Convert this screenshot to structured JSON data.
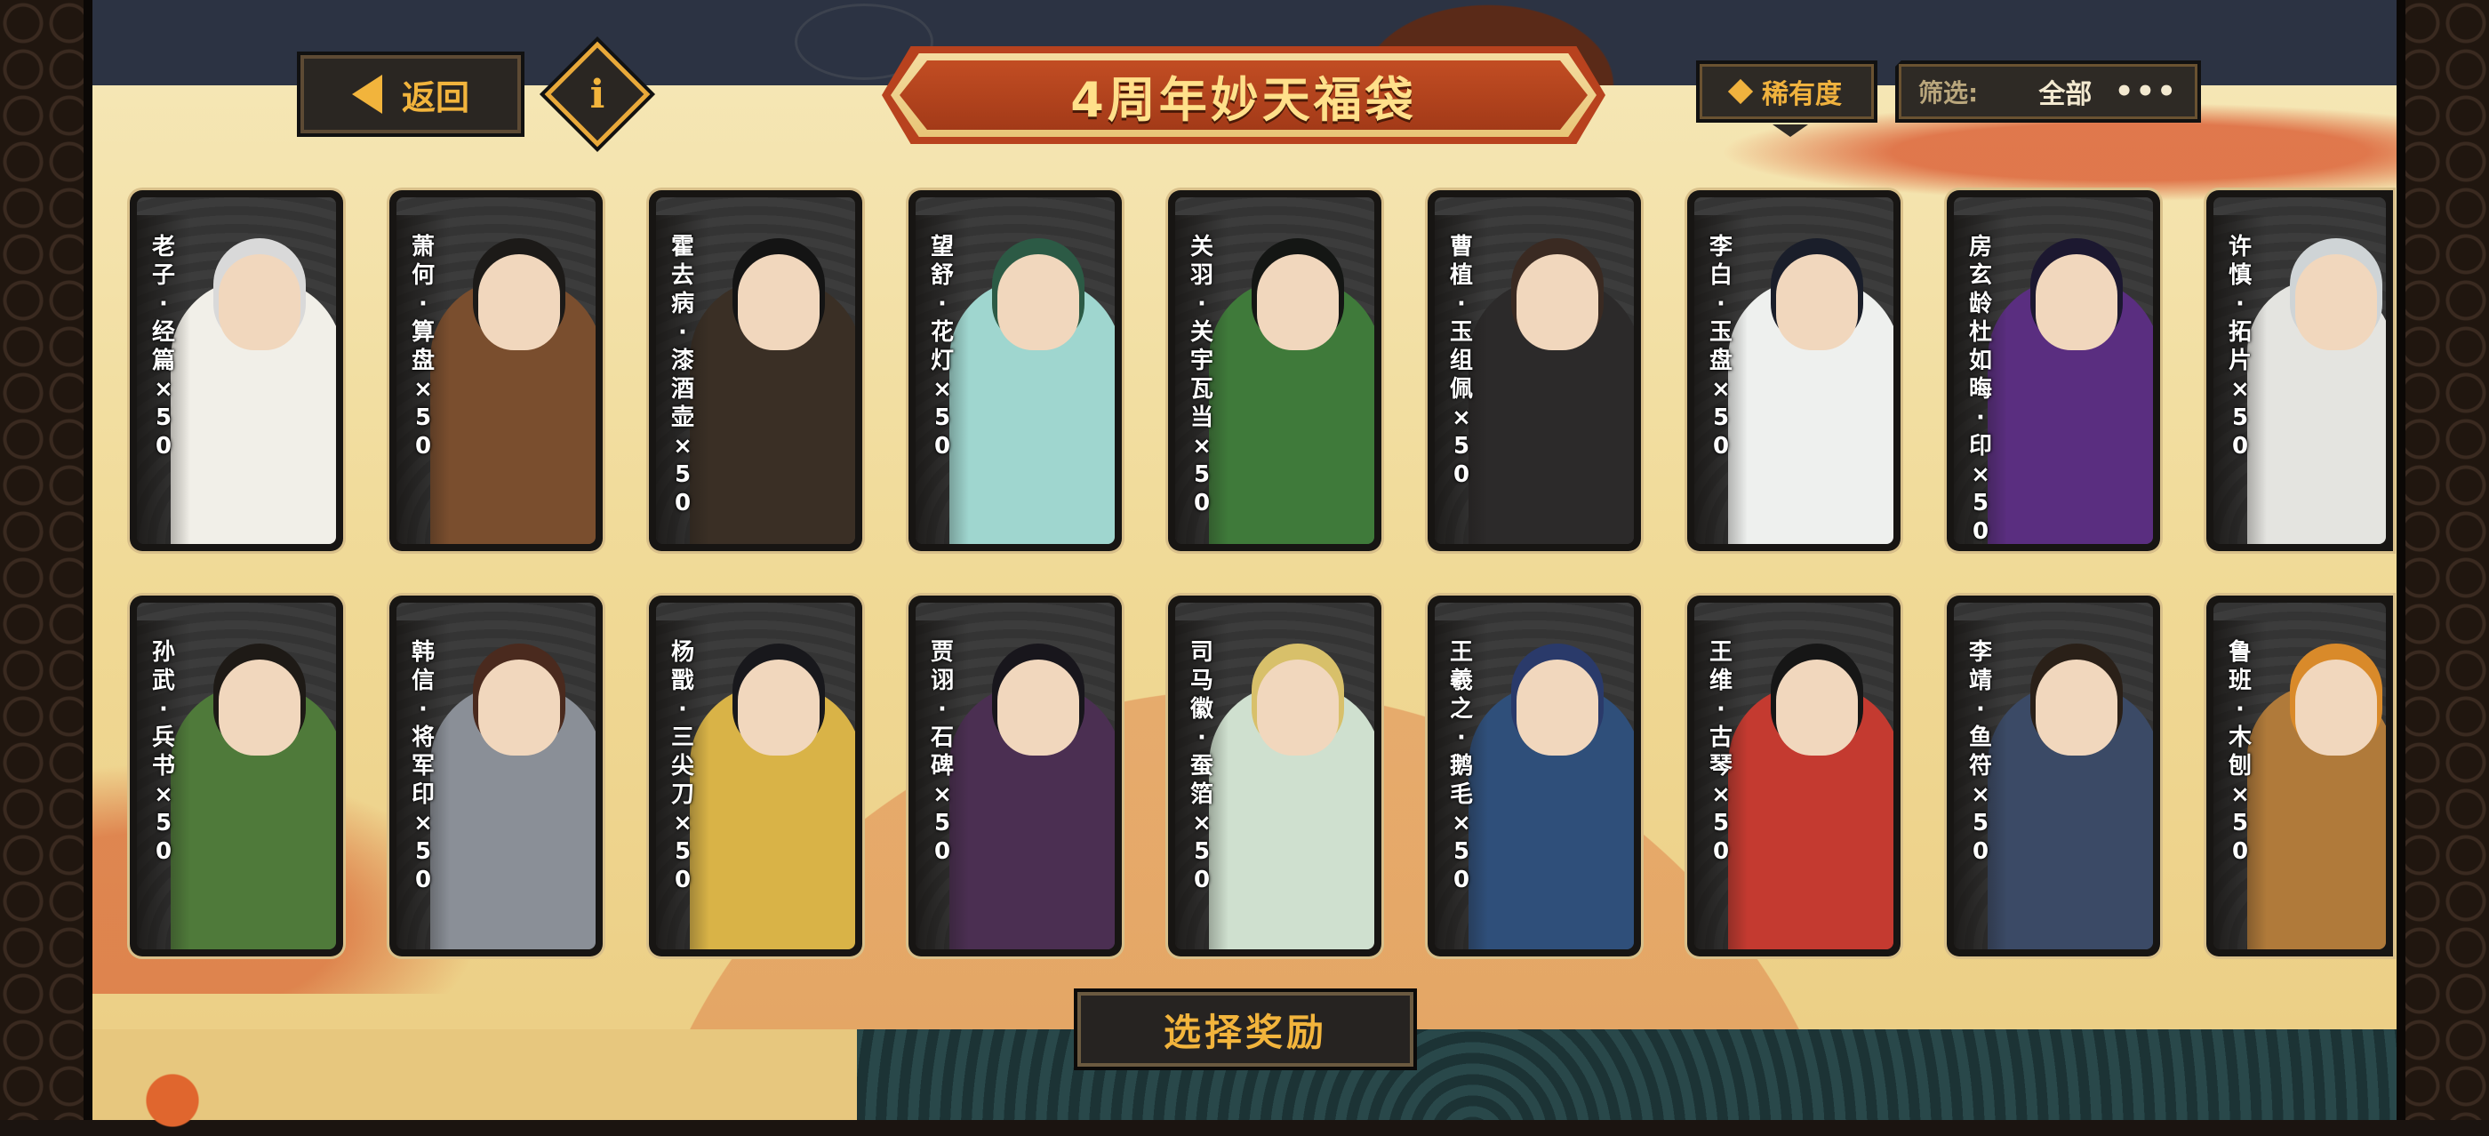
{
  "header": {
    "back_label": "返回",
    "info_icon": "i",
    "title": "4周年妙天福袋",
    "rarity_label": "稀有度",
    "filter_label": "筛选:",
    "filter_value": "全部",
    "more_label": "•••"
  },
  "cards": [
    {
      "label": "老子·经篇×50",
      "colors": {
        "robe": "#f1efe8",
        "hair": "#d9d9d9"
      }
    },
    {
      "label": "萧何·算盘×50",
      "colors": {
        "robe": "#7a4e2e",
        "hair": "#1c1a18"
      }
    },
    {
      "label": "霍去病·漆酒壶×50",
      "colors": {
        "robe": "#3a2f25",
        "hair": "#141414"
      }
    },
    {
      "label": "望舒·花灯×50",
      "colors": {
        "robe": "#9fd6cf",
        "hair": "#2c5a45"
      }
    },
    {
      "label": "关羽·关宇瓦当×50",
      "colors": {
        "robe": "#3f7a3a",
        "hair": "#141614"
      }
    },
    {
      "label": "曹植·玉组佩×50",
      "colors": {
        "robe": "#2c2a2a",
        "hair": "#3a2a22"
      }
    },
    {
      "label": "李白·玉盘×50",
      "colors": {
        "robe": "#eef0ee",
        "hair": "#1a1e2a"
      }
    },
    {
      "label": "房玄龄杜如晦·印×50",
      "colors": {
        "robe": "#5a2e80",
        "hair": "#1c1830"
      }
    },
    {
      "label": "许慎·拓片×50",
      "colors": {
        "robe": "#e4e4e0",
        "hair": "#cfd4d6"
      }
    },
    {
      "label": "孙武·兵书×50",
      "colors": {
        "robe": "#4f7a3a",
        "hair": "#1e1a16"
      }
    },
    {
      "label": "韩信·将军印×50",
      "colors": {
        "robe": "#8a8f97",
        "hair": "#4a2a1e"
      }
    },
    {
      "label": "杨戬·三尖刀×50",
      "colors": {
        "robe": "#d9b347",
        "hair": "#18181c"
      }
    },
    {
      "label": "贾诩·石碑×50",
      "colors": {
        "robe": "#4b2f52",
        "hair": "#18161c"
      }
    },
    {
      "label": "司马徽·蚕箔×50",
      "colors": {
        "robe": "#cfe0cf",
        "hair": "#d8c06a"
      }
    },
    {
      "label": "王羲之·鹅毛×50",
      "colors": {
        "robe": "#2f4f7a",
        "hair": "#2a3a6a"
      }
    },
    {
      "label": "王维·古琴×50",
      "colors": {
        "robe": "#c43a30",
        "hair": "#161616"
      }
    },
    {
      "label": "李靖·鱼符×50",
      "colors": {
        "robe": "#3b4a66",
        "hair": "#2a2018"
      }
    },
    {
      "label": "鲁班·木刨×50",
      "colors": {
        "robe": "#b07a3a",
        "hair": "#d98a2a"
      }
    }
  ],
  "footer": {
    "confirm_label": "选择奖励"
  }
}
